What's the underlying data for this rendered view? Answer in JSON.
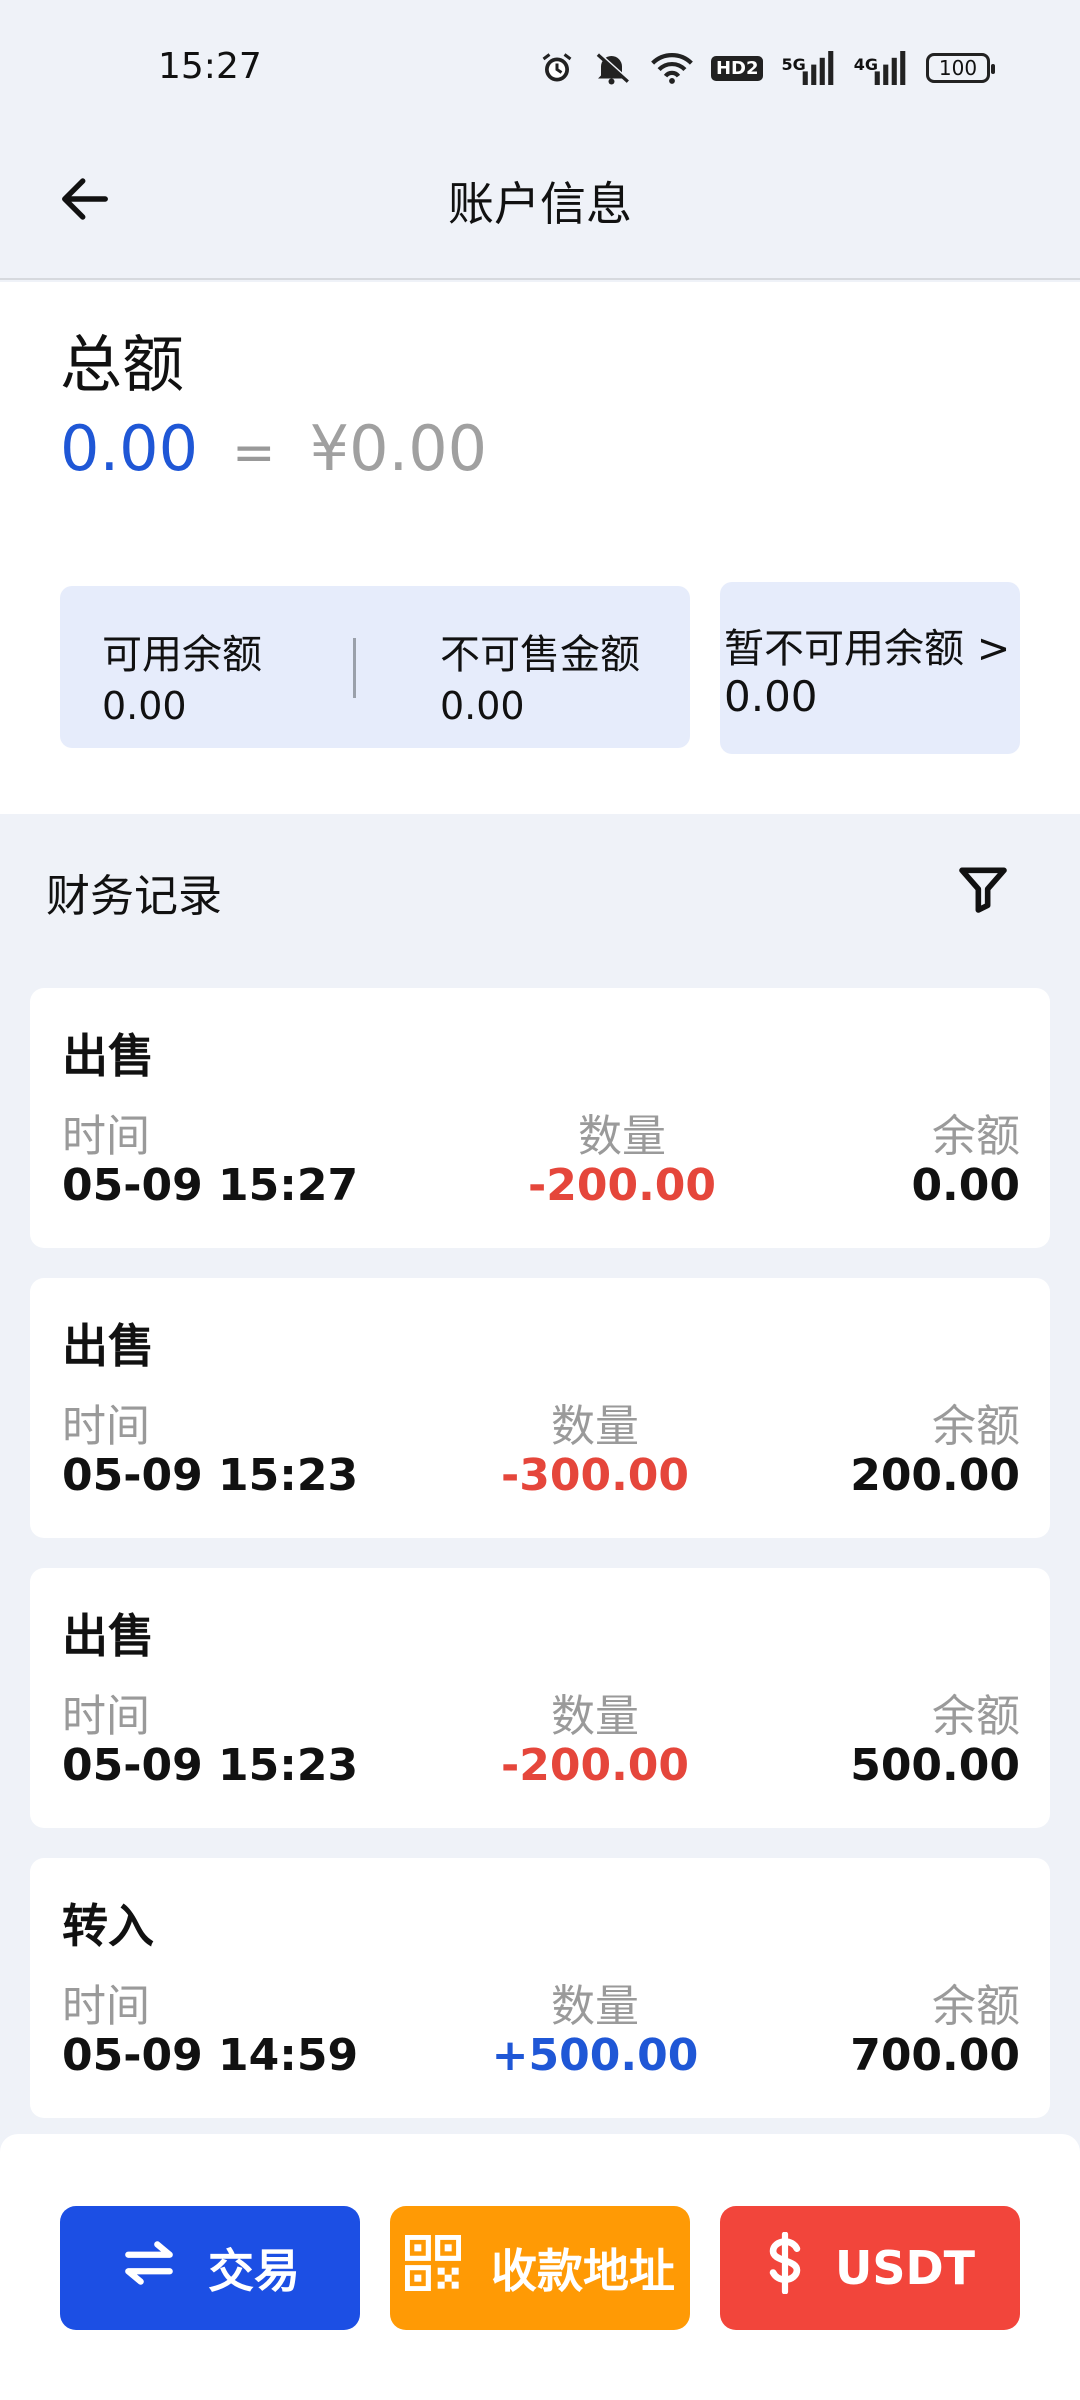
{
  "status_bar": {
    "time": "15:27",
    "icons": [
      "alarm-icon",
      "mute-icon",
      "wifi-icon",
      "hd-icon",
      "signal-5g-icon",
      "signal-4g-icon",
      "battery-icon"
    ],
    "hd_label": "HD2",
    "net1_label": "5G",
    "net2_label": "4G",
    "battery_level": "100"
  },
  "header": {
    "back_icon": "back-arrow-icon",
    "title": "账户信息"
  },
  "summary": {
    "total_label": "总额",
    "total_value": "0.00",
    "equals": "=",
    "total_cny": "¥0.00",
    "available_label": "可用余额",
    "available_value": "0.00",
    "unsellable_label": "不可售金额",
    "unsellable_value": "0.00",
    "unavailable_label": "暂不可用余额 >",
    "unavailable_value": "0.00"
  },
  "records": {
    "title": "财务记录",
    "filter_icon": "filter-icon",
    "columns": {
      "time": "时间",
      "qty": "数量",
      "balance": "余额"
    },
    "items": [
      {
        "type": "出售",
        "time": "05-09 15:27",
        "qty": "-200.00",
        "balance": "0.00",
        "sign": "neg"
      },
      {
        "type": "出售",
        "time": "05-09 15:23",
        "qty": "-300.00",
        "balance": "200.00",
        "sign": "neg"
      },
      {
        "type": "出售",
        "time": "05-09 15:23",
        "qty": "-200.00",
        "balance": "500.00",
        "sign": "neg"
      },
      {
        "type": "转入",
        "time": "05-09 14:59",
        "qty": "+500.00",
        "balance": "700.00",
        "sign": "pos"
      }
    ]
  },
  "bottom_bar": {
    "trade_label": "交易",
    "address_label": "收款地址",
    "usdt_label": "USDT",
    "colors": {
      "trade": "#1c4fe4",
      "address": "#ff9a05",
      "usdt": "#f2453b"
    }
  }
}
